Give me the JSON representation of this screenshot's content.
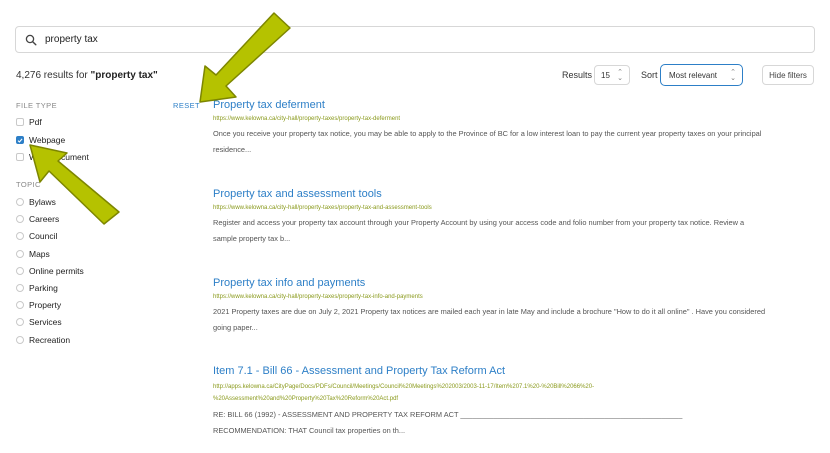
{
  "search": {
    "value": "property tax",
    "placeholder": ""
  },
  "summary": {
    "count": "4,276",
    "prefix": " results for ",
    "query_quoted": "\"property tax\""
  },
  "controls": {
    "results_label": "Results",
    "results_value": "15",
    "sort_label": "Sort",
    "sort_value": "Most relevant",
    "hide_filters_label": "Hide filters"
  },
  "filters": {
    "file_type_heading": "FILE TYPE",
    "reset_label": "RESET",
    "file_types": [
      {
        "label": "Pdf",
        "checked": false
      },
      {
        "label": "Webpage",
        "checked": true
      },
      {
        "label": "Word document",
        "checked": false
      }
    ],
    "topic_heading": "TOPIC",
    "topics": [
      "Bylaws",
      "Careers",
      "Council",
      "Maps",
      "Online permits",
      "Parking",
      "Property",
      "Services",
      "Recreation"
    ]
  },
  "results": [
    {
      "title": "Property tax deferment",
      "url": "https://www.kelowna.ca/city-hall/property-taxes/property-tax-deferment",
      "snippet_line1": "Once you receive your property tax notice, you may be able to apply to the Province of BC for a low interest loan to pay the current year property taxes on your principal",
      "snippet_line2": "residence..."
    },
    {
      "title": "Property tax and assessment tools",
      "url": "https://www.kelowna.ca/city-hall/property-taxes/property-tax-and-assessment-tools",
      "snippet_line1": "Register and access your property tax account through your Property Account by using your access code and folio number from your property tax notice. Review a",
      "snippet_line2": "sample property tax b..."
    },
    {
      "title": "Property tax info and payments",
      "url": "https://www.kelowna.ca/city-hall/property-taxes/property-tax-info-and-payments",
      "snippet_line1": "2021 Property taxes are due on July 2, 2021 Property tax notices are mailed each year in late May and include a brochure \"How to do it all online\" . Have you considered",
      "snippet_line2": "going paper..."
    },
    {
      "title": "Item 7.1 - Bill 66 - Assessment and Property Tax Reform Act",
      "url_line1": "http://apps.kelowna.ca/CityPage/Docs/PDFs/Council/Meetings/Council%20Meetings%202003/2003-11-17/Item%207.1%20-%20Bill%2066%20-",
      "url_line2": "%20Assessment%20and%20Property%20Tax%20Reform%20Act.pdf",
      "snippet_line1": "RE: BILL 66 (1992) - ASSESSMENT AND PROPERTY TAX REFORM ACT ______________________________________________________",
      "snippet_line2": "RECOMMENDATION: THAT Council tax properties on th..."
    }
  ],
  "icons": {
    "search": "search-icon",
    "checkmark": "checkmark-icon",
    "updown": "up-down-chevron-icon"
  },
  "colors": {
    "link": "#2d7fc7",
    "url": "#8a9a1c",
    "annotation_arrow": "#b5c200"
  }
}
